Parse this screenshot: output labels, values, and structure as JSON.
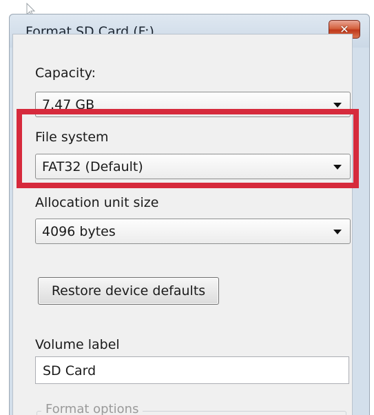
{
  "window": {
    "title": "Format SD Card (F:)",
    "close_icon": "close-icon"
  },
  "capacity": {
    "label": "Capacity:",
    "value": "7.47 GB"
  },
  "file_system": {
    "label": "File system",
    "value": "FAT32 (Default)",
    "highlight_color": "#d62a3c"
  },
  "allocation_unit": {
    "label": "Allocation unit size",
    "value": "4096 bytes"
  },
  "restore_button": {
    "label": "Restore device defaults"
  },
  "volume_label": {
    "label": "Volume label",
    "value": "SD Card"
  },
  "format_options": {
    "title": "Format options"
  },
  "icons": {
    "cursor": "mouse-pointer-icon",
    "dropdown": "chevron-down-icon"
  }
}
